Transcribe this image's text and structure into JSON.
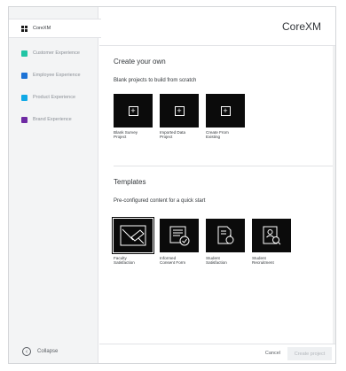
{
  "sidebar": {
    "items": [
      {
        "label": "CoreXM",
        "color": "#1a1a1a",
        "icon": "corexm-icon"
      },
      {
        "label": "Customer Experience",
        "color": "#21c5a5",
        "icon": "customer-experience-icon"
      },
      {
        "label": "Employee Experience",
        "color": "#1d73d6",
        "icon": "employee-experience-icon"
      },
      {
        "label": "Product Experience",
        "color": "#10a9e6",
        "icon": "product-experience-icon"
      },
      {
        "label": "Brand Experience",
        "color": "#6e2aa3",
        "icon": "brand-experience-icon"
      }
    ],
    "collapse_label": "Collapse"
  },
  "header": {
    "brand": "CoreXM"
  },
  "create_section": {
    "title": "Create your own",
    "subtitle": "Blank projects to build from scratch",
    "tiles": [
      {
        "label_line1": "Blank Survey",
        "label_line2": "Project"
      },
      {
        "label_line1": "Imported Data",
        "label_line2": "Project"
      },
      {
        "label_line1": "Create From",
        "label_line2": "Existing"
      }
    ]
  },
  "templates_section": {
    "title": "Templates",
    "subtitle": "Pre-configured content for a quick start",
    "tiles": [
      {
        "label_line1": "Faculty",
        "label_line2": "Satisfaction",
        "icon": "edit-document-icon"
      },
      {
        "label_line1": "Informed",
        "label_line2": "Consent Form",
        "icon": "form-check-icon"
      },
      {
        "label_line1": "Student",
        "label_line2": "Satisfaction",
        "icon": "document-apple-icon"
      },
      {
        "label_line1": "Student",
        "label_line2": "Recruitment",
        "icon": "profile-search-icon"
      }
    ]
  },
  "footer": {
    "cancel_label": "Cancel",
    "create_label": "Create project"
  },
  "colors": {
    "accent": "#0b0b0b",
    "sidebar_bg": "#f3f4f5"
  }
}
